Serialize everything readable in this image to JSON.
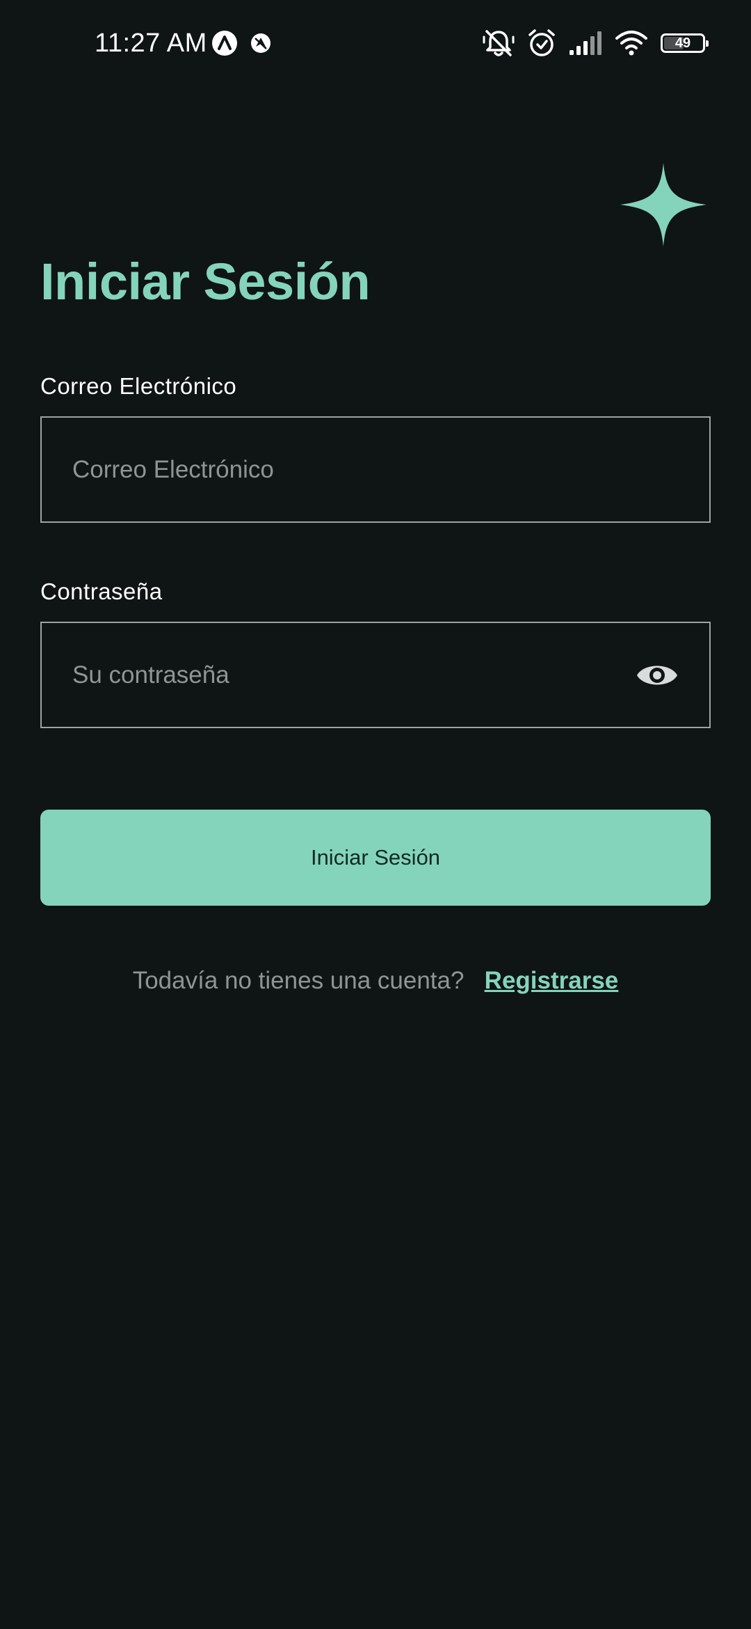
{
  "status_bar": {
    "time": "11:27 AM",
    "battery_level": "49",
    "icons_left": [
      "app-notification-icon",
      "navigation-app-icon"
    ],
    "icons_right": [
      "silent-bell-icon",
      "alarm-icon",
      "signal-icon",
      "wifi-icon",
      "battery-icon"
    ]
  },
  "login": {
    "title": "Iniciar Sesión",
    "email": {
      "label": "Correo Electrónico",
      "placeholder": "Correo Electrónico",
      "value": ""
    },
    "password": {
      "label": "Contraseña",
      "placeholder": "Su contraseña",
      "value": "",
      "toggle_icon": "eye-icon"
    },
    "submit_label": "Iniciar Sesión",
    "signup_prompt": "Todavía no tienes una cuenta?",
    "signup_link": "Registrarse"
  },
  "colors": {
    "background": "#0f1414",
    "accent": "#84d4bb",
    "input_border": "#9ea3a3",
    "muted_text": "#8f9494",
    "button_text": "#0f2a22"
  }
}
